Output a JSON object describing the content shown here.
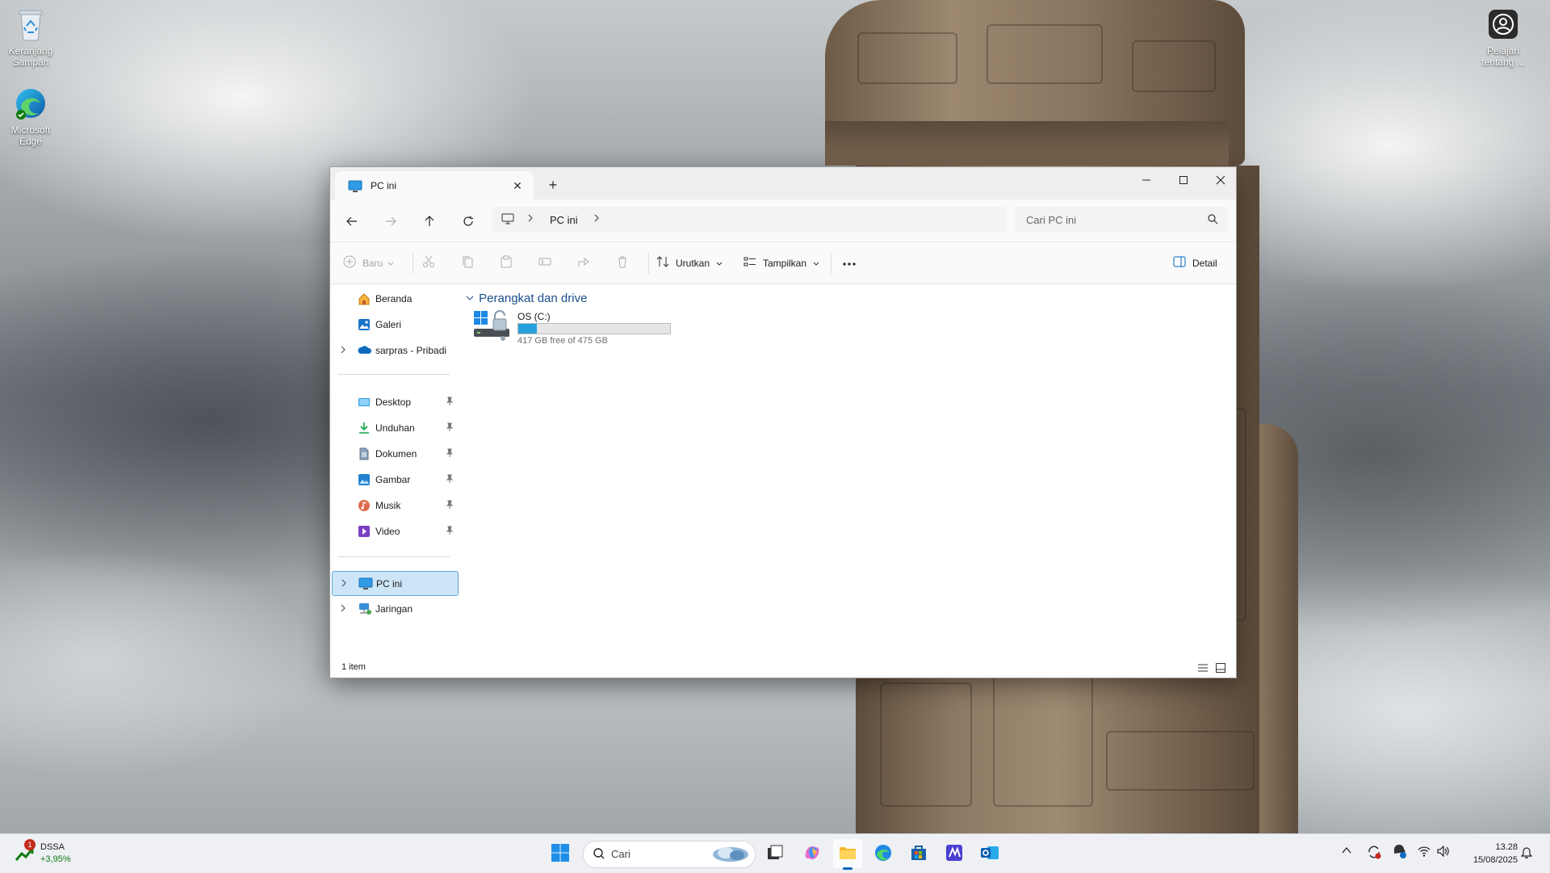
{
  "desktop": {
    "icons": [
      {
        "label": "Keranjang Sampah",
        "icon": "recycle-bin-icon"
      },
      {
        "label": "Microsoft Edge",
        "icon": "edge-icon"
      },
      {
        "label": "Pelajari tentang ...",
        "icon": "learn-about-picture-icon"
      }
    ]
  },
  "window": {
    "tab_title": "PC ini",
    "breadcrumb": [
      "PC ini"
    ],
    "search_placeholder": "Cari PC ini",
    "commands": {
      "new": "Baru",
      "sort": "Urutkan",
      "view": "Tampilkan",
      "details": "Detail"
    },
    "sidebar": {
      "top": [
        {
          "label": "Beranda",
          "icon": "home-icon"
        },
        {
          "label": "Galeri",
          "icon": "gallery-icon"
        },
        {
          "label": "sarpras - Pribadi",
          "icon": "onedrive-icon"
        }
      ],
      "pinned": [
        {
          "label": "Desktop",
          "icon": "desktop-folder-icon"
        },
        {
          "label": "Unduhan",
          "icon": "downloads-icon"
        },
        {
          "label": "Dokumen",
          "icon": "documents-icon"
        },
        {
          "label": "Gambar",
          "icon": "pictures-icon"
        },
        {
          "label": "Musik",
          "icon": "music-icon"
        },
        {
          "label": "Video",
          "icon": "videos-icon"
        }
      ],
      "bottom": [
        {
          "label": "PC ini",
          "icon": "this-pc-icon",
          "selected": true
        },
        {
          "label": "Jaringan",
          "icon": "network-icon"
        }
      ]
    },
    "group_header": "Perangkat dan drive",
    "drives": [
      {
        "name": "OS (C:)",
        "free_text": "417 GB free of 475 GB",
        "used_fraction": 0.12,
        "bar_color": "#26a0da"
      }
    ],
    "status": "1 item"
  },
  "taskbar": {
    "widget": {
      "badge": "1",
      "ticker": "DSSA",
      "change": "+3,95%",
      "change_color": "#107c10"
    },
    "search_placeholder": "Cari",
    "apps": [
      "start-icon",
      "task-view-icon",
      "copilot-icon",
      "file-explorer-icon",
      "edge-icon",
      "store-icon",
      "ms365-icon",
      "outlook-icon"
    ],
    "clock": {
      "time": "13.28",
      "date": "15/08/2025"
    }
  },
  "colors": {
    "accent": "#0067c0",
    "selection": "#cde6f7",
    "header_blue": "#1b4e8a"
  }
}
